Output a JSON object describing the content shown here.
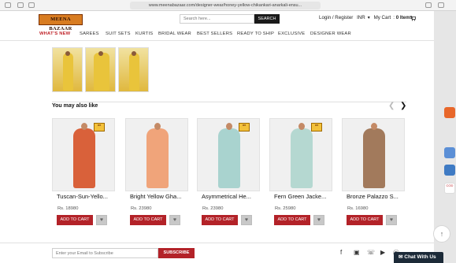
{
  "browser": {
    "url": "www.meenabazaar.com/designer-wear/honey-yellow-chikankari-anarkali-ensu..."
  },
  "header": {
    "logo_text": "MEENA BAZAAR",
    "search_placeholder": "Search here...",
    "search_button": "SEARCH",
    "login_label": "Login / Register",
    "currency_label": "INR",
    "cart_label": "My Cart",
    "cart_count": "0 Items"
  },
  "nav": [
    {
      "label": "WHAT'S NEW",
      "active": true
    },
    {
      "label": "SAREES"
    },
    {
      "label": "SUIT SETS"
    },
    {
      "label": "KURTIS"
    },
    {
      "label": "BRIDAL WEAR"
    },
    {
      "label": "BEST SELLERS"
    },
    {
      "label": "READY TO SHIP"
    },
    {
      "label": "EXCLUSIVE"
    },
    {
      "label": "DESIGNER WEAR"
    }
  ],
  "section": {
    "title": "You may also like",
    "prev_icon": "chevron-left-icon",
    "next_icon": "chevron-right-icon"
  },
  "products": [
    {
      "name": "Tuscan-Sun-Yello...",
      "price": "Rs. 18980",
      "add_label": "ADD TO CART",
      "color": "#d9613a",
      "badge": "MEENA BAZAAR"
    },
    {
      "name": "Bright Yellow Gha...",
      "price": "Rs. 23980",
      "add_label": "ADD TO CART",
      "color": "#f0a47a",
      "badge": ""
    },
    {
      "name": "Asymmetrical He...",
      "price": "Rs. 23980",
      "add_label": "ADD TO CART",
      "color": "#a9d3cf",
      "badge": "MEENA BAZAAR"
    },
    {
      "name": "Fern Green Jacke...",
      "price": "Rs. 25980",
      "add_label": "ADD TO CART",
      "color": "#b5d8d1",
      "badge": "MEENA BAZAAR"
    },
    {
      "name": "Bronze Palazzo S...",
      "price": "Rs. 16980",
      "add_label": "ADD TO CART",
      "color": "#a27a5c",
      "badge": ""
    }
  ],
  "footer": {
    "email_placeholder": "Enter your Email to Subscribe",
    "subscribe_label": "SUBSCRIBE",
    "social": [
      "facebook-icon",
      "instagram-icon",
      "whatsapp-icon",
      "youtube-icon",
      "pinterest-icon"
    ]
  },
  "chat": {
    "label": "Chat With Us"
  },
  "colors": {
    "brand_red": "#b32228",
    "nav_active": "#c0252b",
    "logo_bg": "#d87c21"
  }
}
